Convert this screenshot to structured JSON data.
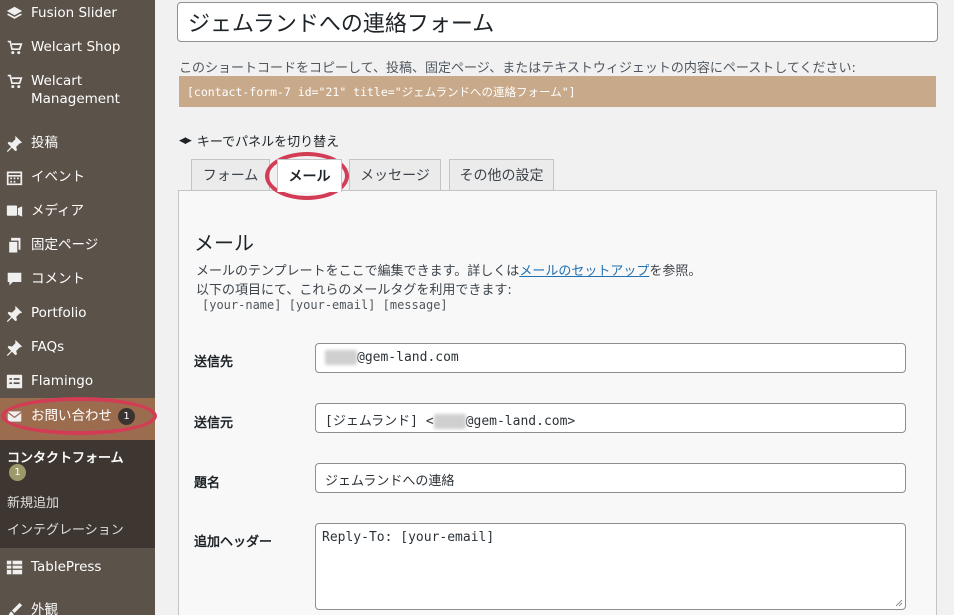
{
  "sidebar": {
    "items": [
      {
        "label": "Fusion Slider",
        "icon": "layers-icon"
      },
      {
        "label": "Welcart Shop",
        "icon": "cart-icon"
      },
      {
        "label": "Welcart Management",
        "icon": "cart-icon"
      },
      {
        "label": "投稿",
        "icon": "pin-icon"
      },
      {
        "label": "イベント",
        "icon": "calendar-icon"
      },
      {
        "label": "メディア",
        "icon": "media-icon"
      },
      {
        "label": "固定ページ",
        "icon": "pages-icon"
      },
      {
        "label": "コメント",
        "icon": "comment-icon"
      },
      {
        "label": "Portfolio",
        "icon": "pin-icon"
      },
      {
        "label": "FAQs",
        "icon": "pin-icon"
      },
      {
        "label": "Flamingo",
        "icon": "list-icon"
      },
      {
        "label": "お問い合わせ",
        "icon": "mail-icon",
        "badge": "1"
      },
      {
        "label": "TablePress",
        "icon": "table-icon"
      },
      {
        "label": "外観",
        "icon": "brush-icon"
      }
    ],
    "submenu": {
      "current": "コンタクトフォーム",
      "current_badge": "1",
      "add_new": "新規追加",
      "integration": "インテグレーション"
    }
  },
  "form": {
    "title": "ジェムランドへの連絡フォーム",
    "shortcode_desc": "このショートコードをコピーして、投稿、固定ページ、またはテキストウィジェットの内容にペーストしてください:",
    "shortcode": "[contact-form-7 id=\"21\" title=\"ジェムランドへの連絡フォーム\"]",
    "keyhint": "キーでパネルを切り替え"
  },
  "tabs": [
    {
      "label": "フォーム"
    },
    {
      "label": "メール"
    },
    {
      "label": "メッセージ"
    },
    {
      "label": "その他の設定"
    }
  ],
  "panel": {
    "heading": "メール",
    "desc1_prefix": "メールのテンプレートをここで編集できます。詳しくは",
    "desc1_link": "メールのセットアップ",
    "desc1_suffix": "を参照。",
    "desc2": "以下の項目にて、これらのメールタグを利用できます:",
    "mail_tags": "[your-name] [your-email] [message]",
    "fields": {
      "to_label": "送信先",
      "to_value_suffix": "@gem-land.com",
      "from_label": "送信元",
      "from_value_prefix": "[ジェムランド] <",
      "from_value_suffix": "@gem-land.com>",
      "subject_label": "題名",
      "subject_value": "ジェムランドへの連絡",
      "headers_label": "追加ヘッダー",
      "headers_value": "Reply-To: [your-email]"
    }
  },
  "colors": {
    "sidebar_bg": "#5b5249",
    "sidebar_active": "#9c6c4e",
    "submenu_bg": "#3e3731",
    "shortcode_bg": "#c8a98a",
    "highlight": "#d23c55",
    "link": "#2271b1"
  }
}
